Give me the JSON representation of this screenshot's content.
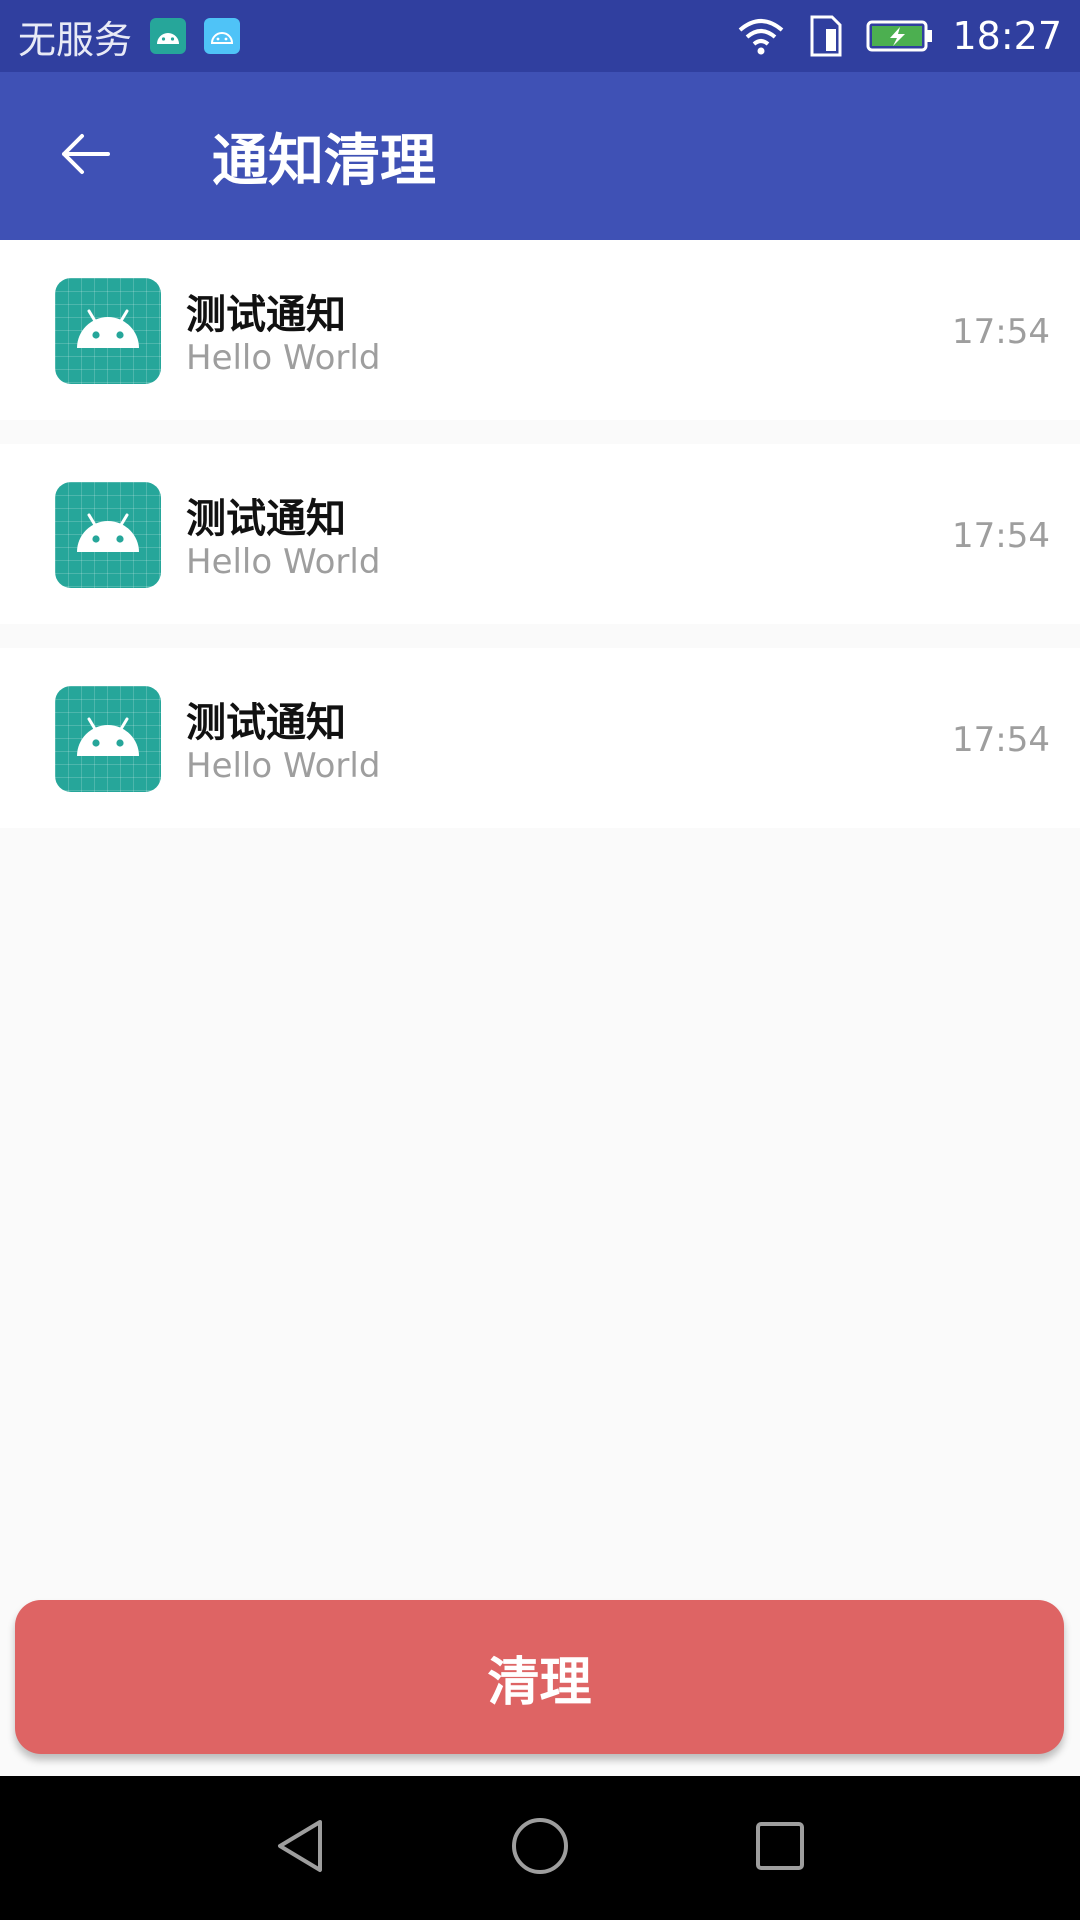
{
  "status_bar": {
    "carrier": "无服务",
    "time": "18:27",
    "icons": [
      "android-app-icon",
      "android-outline-icon",
      "wifi-icon",
      "sim-icon",
      "battery-charging-icon"
    ]
  },
  "app_bar": {
    "title": "通知清理",
    "back_icon": "arrow-left-icon"
  },
  "notifications": [
    {
      "title": "测试通知",
      "text": "Hello World",
      "time": "17:54",
      "icon": "android-app-icon"
    },
    {
      "title": "测试通知",
      "text": "Hello World",
      "time": "17:54",
      "icon": "android-app-icon"
    },
    {
      "title": "测试通知",
      "text": "Hello World",
      "time": "17:54",
      "icon": "android-app-icon"
    }
  ],
  "clean_button": {
    "label": "清理"
  },
  "nav_bar": {
    "icons": [
      "back-triangle-icon",
      "home-circle-icon",
      "recents-square-icon"
    ]
  },
  "colors": {
    "status_bar": "#303f9f",
    "app_bar": "#3f51b5",
    "icon_teal": "#26a69a",
    "clean_button": "#de6464",
    "divider": "#eeeeee",
    "background": "#fafafa"
  }
}
